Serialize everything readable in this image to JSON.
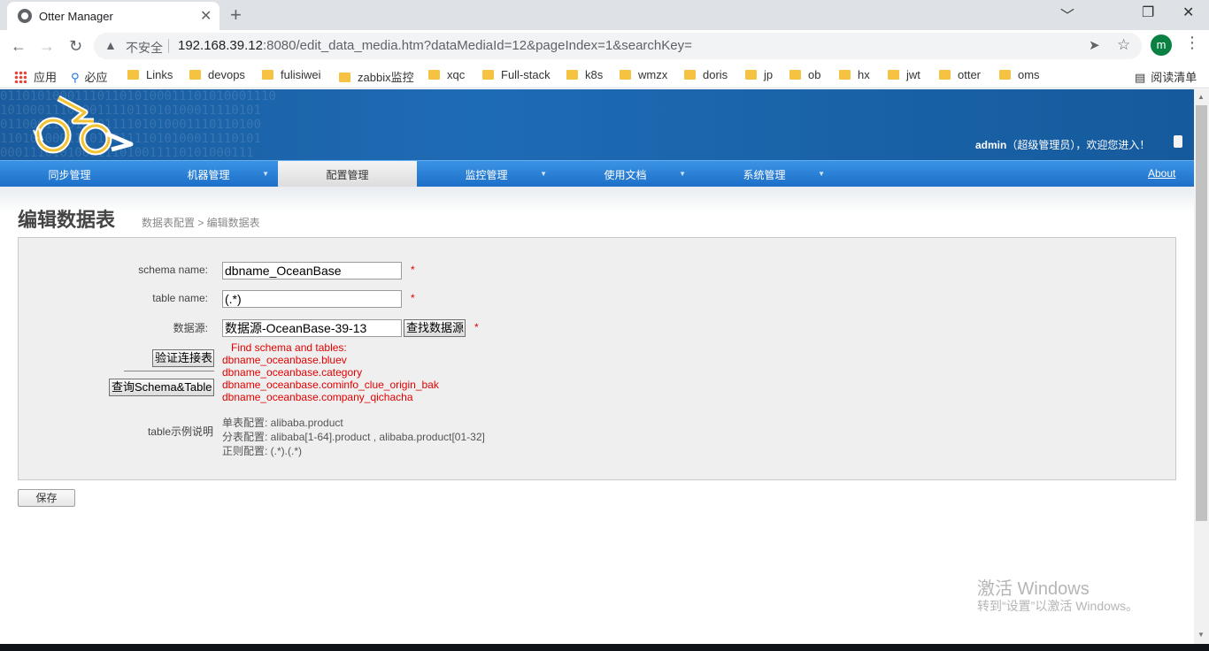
{
  "browser": {
    "tab_title": "Otter Manager",
    "tab_close": "✕",
    "new_tab": "+",
    "window_controls": {
      "minimize": "﹀",
      "restore": "❐",
      "close": "✕"
    },
    "insecure_label": "不安全",
    "url_host": "192.168.39.12",
    "url_rest": ":8080/edit_data_media.htm?dataMediaId=12&pageIndex=1&searchKey=",
    "profile_initial": "m",
    "bookmarks": [
      "应用",
      "必应",
      "Links",
      "devops",
      "fulisiwei",
      "zabbix监控",
      "xqc",
      "Full-stack",
      "k8s",
      "wmzx",
      "doris",
      "jp",
      "ob",
      "hx",
      "jwt",
      "otter",
      "oms"
    ],
    "reading_list": "阅读清单"
  },
  "header": {
    "user": "admin",
    "welcome_rest": "（超级管理员），欢迎您进入！"
  },
  "nav": {
    "items": [
      {
        "label": "同步管理",
        "dropdown": false,
        "active": false
      },
      {
        "label": "机器管理",
        "dropdown": true,
        "active": false
      },
      {
        "label": "配置管理",
        "dropdown": false,
        "active": true
      },
      {
        "label": "监控管理",
        "dropdown": true,
        "active": false
      },
      {
        "label": "使用文档",
        "dropdown": true,
        "active": false
      },
      {
        "label": "系统管理",
        "dropdown": true,
        "active": false
      }
    ],
    "arrow": "▼",
    "about": "About"
  },
  "page": {
    "title": "编辑数据表",
    "breadcrumb": "数据表配置  >  编辑数据表"
  },
  "form": {
    "schema_label": "schema name:",
    "schema_value": "dbname_OceanBase",
    "table_label": "table name:",
    "table_value": "(.*)",
    "datasource_label": "数据源:",
    "datasource_value": "数据源-OceanBase-39-13",
    "find_datasource_button": "查找数据源",
    "required_mark": "*",
    "verify_button": "验证连接表",
    "query_button": "查询Schema&Table",
    "result_header": "Find schema and tables:",
    "result_tables": [
      "dbname_oceanbase.bluev",
      "dbname_oceanbase.category",
      "dbname_oceanbase.cominfo_clue_origin_bak",
      "dbname_oceanbase.company_qichacha"
    ],
    "example_label": "table示例说明",
    "examples": [
      "单表配置: alibaba.product",
      "分表配置: alibaba[1-64].product , alibaba.product[01-32]",
      "正则配置: (.*).(.*)"
    ],
    "save_button": "保存"
  },
  "watermark": {
    "line1": "激活 Windows",
    "line2": "转到“设置”以激活 Windows。"
  }
}
